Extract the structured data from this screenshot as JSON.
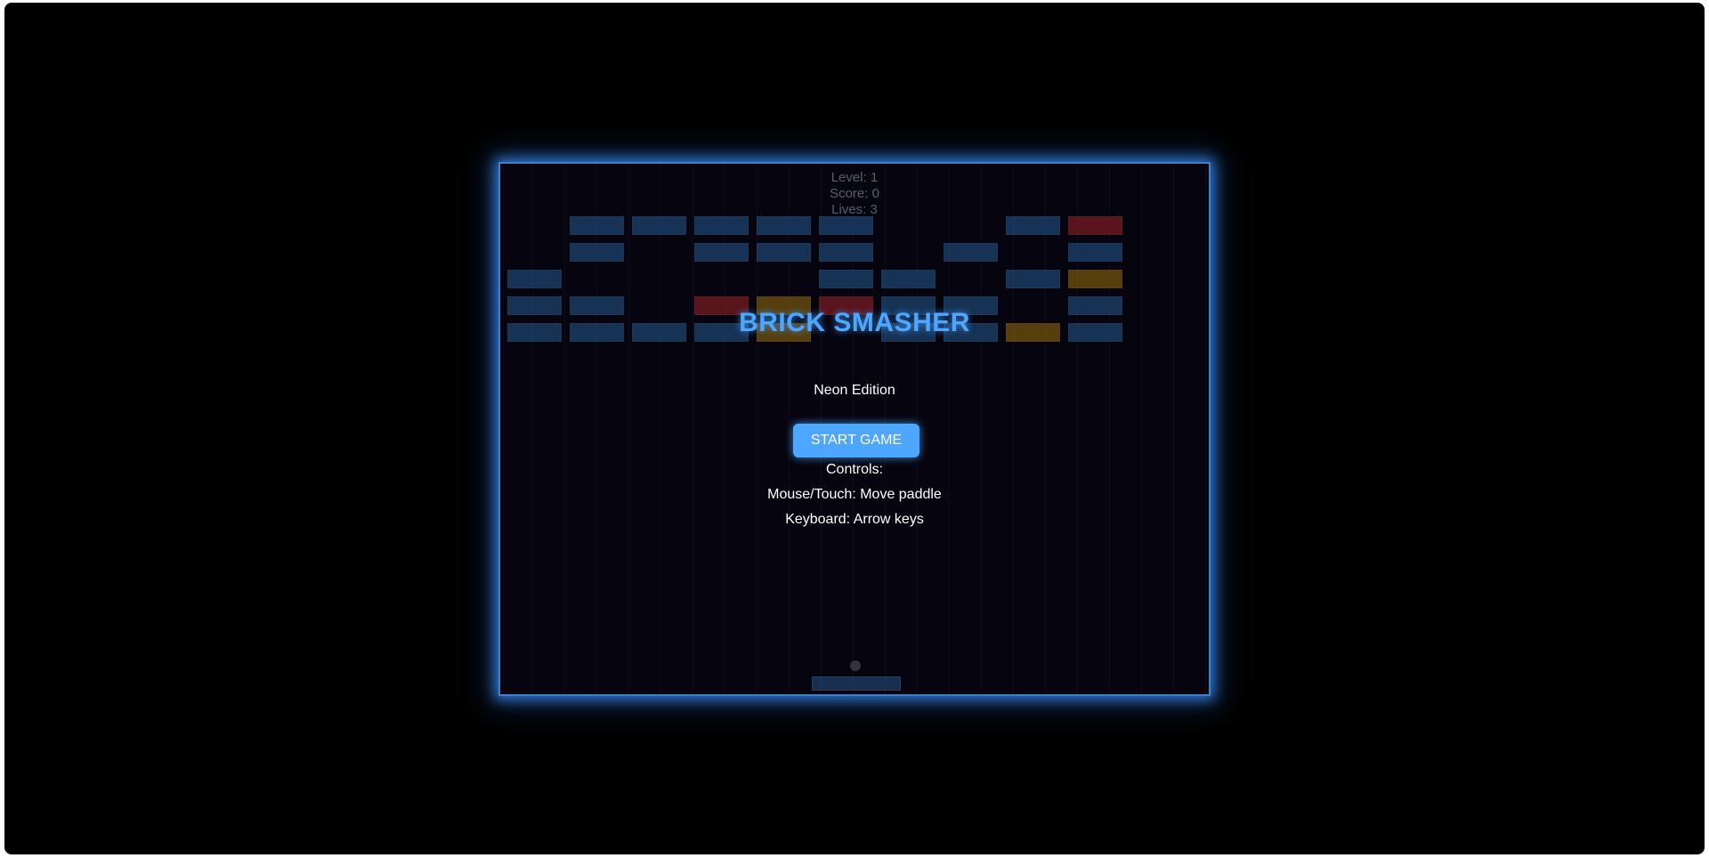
{
  "hud": {
    "level": "Level: 1",
    "score": "Score: 0",
    "lives": "Lives: 3"
  },
  "menu": {
    "title": "BRICK SMASHER",
    "subtitle": "Neon Edition",
    "start_label": "START GAME",
    "controls_heading": "Controls:",
    "controls_mouse": "Mouse/Touch: Move paddle",
    "controls_keyboard": "Keyboard: Arrow keys"
  },
  "colors": {
    "accent": "#4da6ff",
    "frame_glow": "#3a7fd0",
    "brick_blue": "#2a6aa8",
    "brick_red": "#c0282a",
    "brick_yellow": "#b8860b"
  },
  "bricks": [
    [
      "empty",
      "blue",
      "blue",
      "blue",
      "blue",
      "blue",
      "empty",
      "empty",
      "blue",
      "red"
    ],
    [
      "empty",
      "blue",
      "empty",
      "blue",
      "blue",
      "blue",
      "empty",
      "blue",
      "empty",
      "blue"
    ],
    [
      "blue",
      "empty",
      "empty",
      "empty",
      "empty",
      "blue",
      "blue",
      "empty",
      "blue",
      "yellow"
    ],
    [
      "blue",
      "blue",
      "empty",
      "red",
      "yellow",
      "red",
      "blue",
      "blue",
      "empty",
      "blue"
    ],
    [
      "blue",
      "blue",
      "blue",
      "blue",
      "yellow",
      "empty",
      "blue",
      "blue",
      "yellow",
      "blue"
    ]
  ]
}
